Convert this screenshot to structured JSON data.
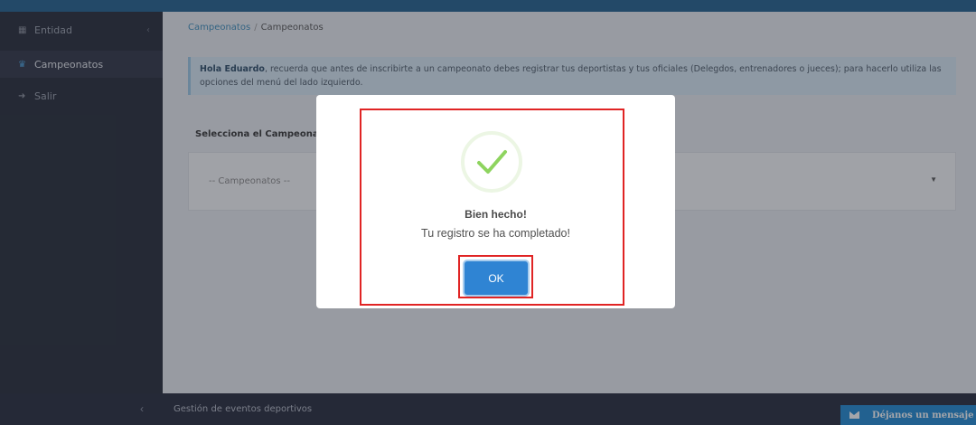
{
  "sidebar": {
    "items": [
      {
        "label": "Entidad",
        "icon": "entity-icon"
      },
      {
        "label": "Campeonatos",
        "icon": "trophy-icon"
      },
      {
        "label": "Salir",
        "icon": "logout-icon"
      }
    ]
  },
  "breadcrumb": {
    "link": "Campeonatos",
    "current": "Campeonatos"
  },
  "alert": {
    "name": "Hola Eduardo",
    "text": ", recuerda que antes de inscribirte a un campeonato debes registrar tus deportistas y tus oficiales (Delegdos, entrenadores o jueces); para hacerlo utiliza las opciones del menú del lado izquierdo."
  },
  "panel": {
    "title": "Selecciona el Campeonato",
    "select_placeholder": "-- Campeonatos --"
  },
  "footer": {
    "text": "Gestión de eventos deportivos",
    "message_button": "Déjanos un mensaje"
  },
  "modal": {
    "title": "Bien hecho!",
    "text": "Tu registro se ha completado!",
    "ok_label": "OK"
  },
  "colors": {
    "accent": "#2f84d3",
    "success": "#8ed45f",
    "highlight": "#e02424"
  }
}
